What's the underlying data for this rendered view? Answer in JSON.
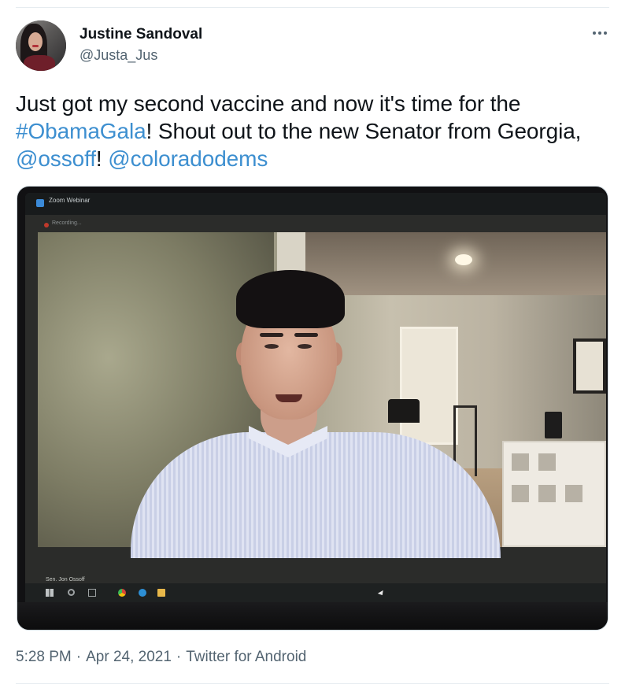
{
  "tweet": {
    "author": {
      "name": "Justine Sandoval",
      "handle": "@Justa_Jus",
      "avatar_icon": "user-avatar-photo"
    },
    "more_icon": "more-options-icon",
    "text": {
      "part1": "Just got my second vaccine and now it's time for the ",
      "hashtag": "#ObamaGala",
      "part2": "! Shout out to the new Senator from Georgia, ",
      "mention1": "@ossoff",
      "part3": "! ",
      "mention2": "@coloradodems"
    },
    "media": {
      "zoom_window_title": "Zoom Webinar",
      "recording_label": "Recording...",
      "participant_name": "Sen. Jon Ossoff"
    },
    "meta": {
      "time": "5:28 PM",
      "separator": "·",
      "date": "Apr 24, 2021",
      "source": "Twitter for Android"
    }
  },
  "colors": {
    "link": "#3d8fd0",
    "secondary_text": "#536471",
    "primary_text": "#0f1419",
    "divider": "#e6ecf0"
  }
}
